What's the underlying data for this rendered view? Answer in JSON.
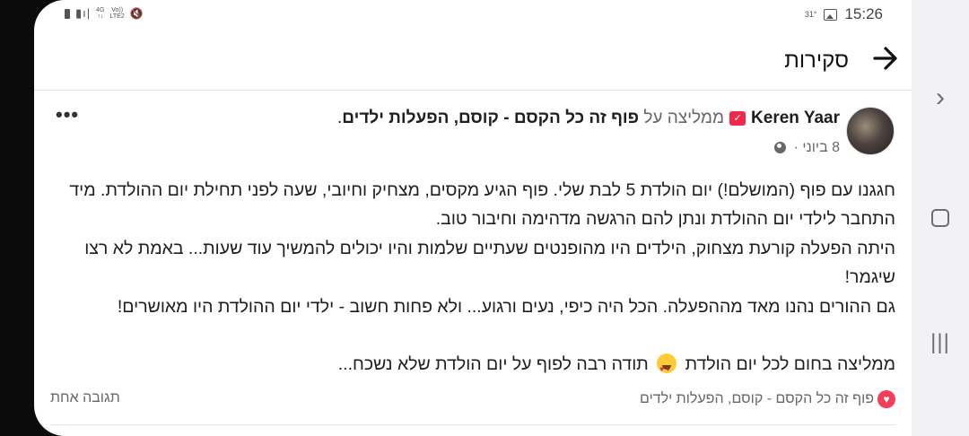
{
  "status_bar": {
    "network_type": "4G",
    "network_sub": "LTE2",
    "volte": "Vo))",
    "temperature": "31°",
    "time": "15:26"
  },
  "header": {
    "title": "סקירות",
    "back_icon": "arrow-right-icon"
  },
  "review": {
    "author": "Keren Yaar",
    "recommends_text": "ממליצה על",
    "page_name": "פוף זה כל הקסם - קוסם, הפעלות ילדים",
    "end_punct": ".",
    "date": "8 ביוני",
    "separator": "·",
    "more_label": "•••",
    "paragraphs": [
      "חגגנו עם פוף (המושלם!) יום הולדת 5 לבת שלי. פוף הגיע מקסים, מצחיק וחיובי, שעה לפני תחילת יום ההולדת. מיד התחבר לילדי יום ההולדת ונתן להם הרגשה מדהימה וחיבור טוב.",
      "היתה הפעלה קורעת מצחוק, הילדים היו מהופנטים שעתיים שלמות והיו יכולים להמשיך עוד שעות... באמת לא רצו שיגמר!",
      "גם ההורים נהנו מאד מההפעלה. הכל היה כיפי, נעים ורגוע... ולא פחות חשוב - ילדי יום ההולדת היו מאושרים!"
    ],
    "closing_part1": "ממליצה בחום לכל יום הולדת",
    "closing_part2": "תודה רבה לפוף על יום הולדת שלא נשכח...",
    "reaction_page": "פוף זה כל הקסם - קוסם, הפעלות ילדים",
    "comments_count": "תגובה אחת"
  }
}
